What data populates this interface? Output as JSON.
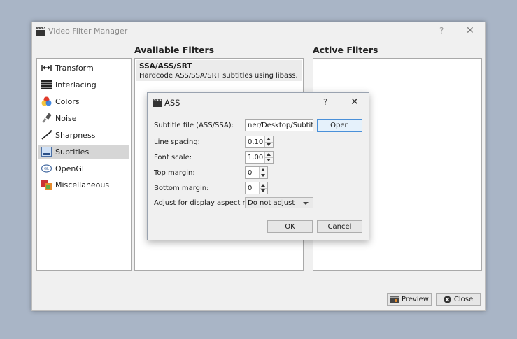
{
  "window": {
    "title": "Video Filter Manager",
    "help": "?",
    "close": "✕"
  },
  "sidebar": {
    "items": [
      {
        "label": "Transform",
        "icon": "transform-icon"
      },
      {
        "label": "Interlacing",
        "icon": "interlacing-icon"
      },
      {
        "label": "Colors",
        "icon": "colors-icon"
      },
      {
        "label": "Noise",
        "icon": "noise-icon"
      },
      {
        "label": "Sharpness",
        "icon": "sharpness-icon"
      },
      {
        "label": "Subtitles",
        "icon": "subtitles-icon",
        "selected": true
      },
      {
        "label": "OpenGl",
        "icon": "opengl-icon"
      },
      {
        "label": "Miscellaneous",
        "icon": "miscellaneous-icon"
      }
    ]
  },
  "available": {
    "heading": "Available Filters",
    "items": [
      {
        "name": "SSA/ASS/SRT",
        "desc": "Hardcode ASS/SSA/SRT subtitles using libass."
      }
    ]
  },
  "active": {
    "heading": "Active Filters"
  },
  "footer": {
    "preview": "Preview",
    "close": "Close"
  },
  "dialog": {
    "title": "ASS",
    "help": "?",
    "close": "✕",
    "subtitle_file_label": "Subtitle file (ASS/SSA):",
    "subtitle_file_value": "ner/Desktop/Subtitle.srt",
    "open": "Open",
    "line_spacing_label": "Line spacing:",
    "line_spacing_value": "0.10",
    "font_scale_label": "Font scale:",
    "font_scale_value": "1.00",
    "top_margin_label": "Top margin:",
    "top_margin_value": "0",
    "bottom_margin_label": "Bottom margin:",
    "bottom_margin_value": "0",
    "aspect_label": "Adjust for display aspect ratio:",
    "aspect_value": "Do not adjust",
    "ok": "OK",
    "cancel": "Cancel"
  },
  "colors": {
    "selection": "#d6d6d6",
    "accent": "#4a90d9",
    "desktop": "#a9b5c6"
  }
}
